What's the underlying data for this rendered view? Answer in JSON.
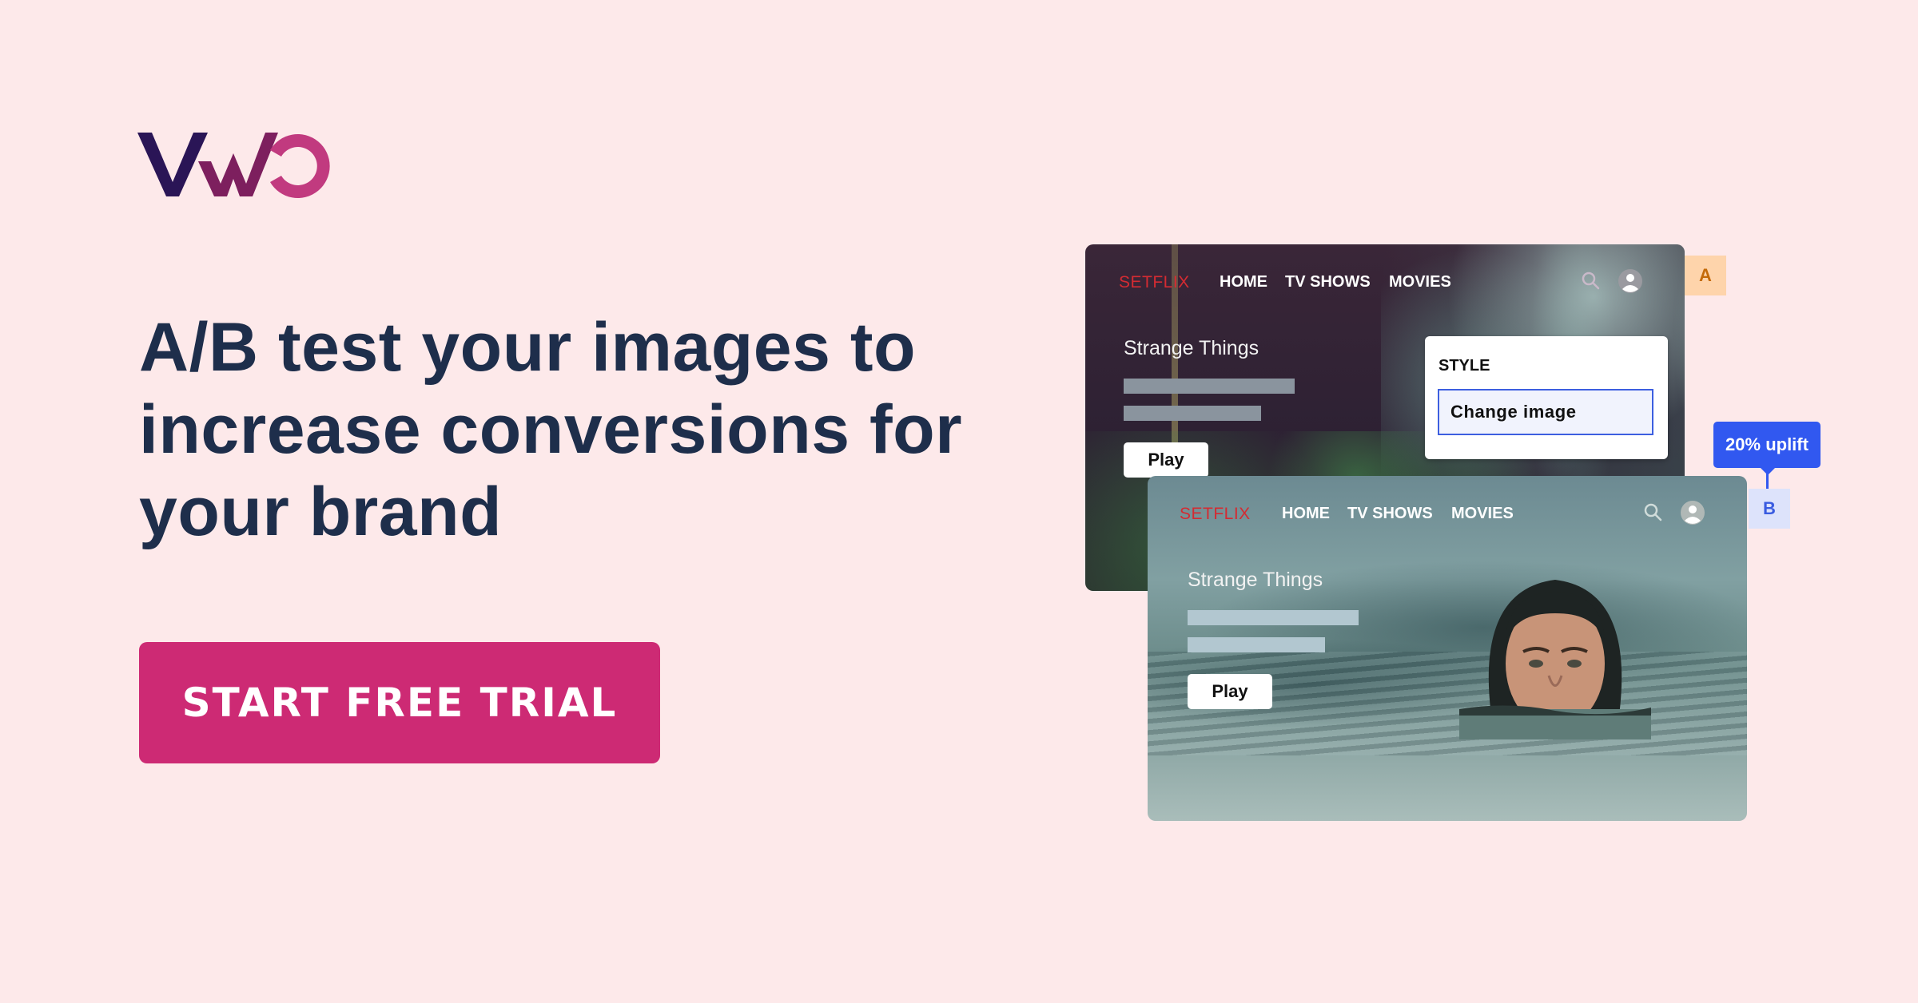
{
  "brand": {
    "logo_text": "VWO",
    "logo_colors": [
      "#2a1556",
      "#7d1f5e",
      "#c13a7f"
    ]
  },
  "hero": {
    "headline_lines": [
      "A/B test your images to",
      "increase conversions for",
      "your brand"
    ],
    "cta_label": "START FREE TRIAL",
    "cta_color": "#cd2a74",
    "headline_color": "#1e2e4b",
    "background_color": "#fde9ea"
  },
  "variant_a": {
    "badge": "A",
    "brand": "SETFLIX",
    "nav": [
      "HOME",
      "TV SHOWS",
      "MOVIES"
    ],
    "icons": [
      "search-icon",
      "user-avatar-icon"
    ],
    "title": "Strange Things",
    "play_label": "Play",
    "image": "forest",
    "style_panel": {
      "heading": "STYLE",
      "option": "Change image"
    }
  },
  "variant_b": {
    "badge": "B",
    "brand": "SETFLIX",
    "nav": [
      "HOME",
      "TV SHOWS",
      "MOVIES"
    ],
    "icons": [
      "search-icon",
      "user-avatar-icon"
    ],
    "title": "Strange Things",
    "play_label": "Play",
    "image": "woman-swimming-in-water",
    "uplift_label": "20% uplift"
  },
  "colors": {
    "badge_a_bg": "#fed4ab",
    "badge_a_fg": "#c46a08",
    "badge_b_bg": "#dde3fb",
    "badge_b_fg": "#3a5ce0",
    "uplift_bg": "#3158f0",
    "brand_red": "#d42b32"
  }
}
